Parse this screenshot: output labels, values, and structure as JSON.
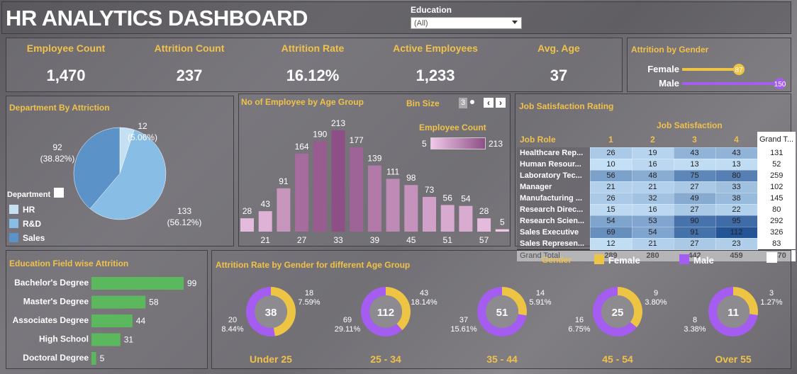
{
  "header": {
    "title": "HR ANALYTICS DASHBOARD",
    "filter_label": "Education",
    "filter_value": "(All)"
  },
  "kpis": [
    {
      "label": "Employee Count",
      "value": "1,470"
    },
    {
      "label": "Attrition Count",
      "value": "237"
    },
    {
      "label": "Attrition Rate",
      "value": "16.12%"
    },
    {
      "label": "Active Employees",
      "value": "1,233"
    },
    {
      "label": "Avg. Age",
      "value": "37"
    }
  ],
  "colors": {
    "accent": "#f0c24b",
    "female": "#eec444",
    "male": "#a55cf0",
    "edu_bar": "#5cb85c",
    "age_bar": "#8e4f86",
    "pie_rd": "#88bde6",
    "pie_sales": "#5b93c9",
    "pie_hr": "#c5e0f3"
  },
  "chart_data": [
    {
      "type": "bar",
      "title": "Attrition by Gender",
      "categories": [
        "Female",
        "Male"
      ],
      "values": [
        87,
        150
      ]
    },
    {
      "type": "pie",
      "title": "Department By Attriction",
      "legend_title": "Department",
      "categories": [
        "HR",
        "R&D",
        "Sales"
      ],
      "values": [
        12,
        133,
        92
      ],
      "labels": [
        [
          "12",
          "(5.06%)"
        ],
        [
          "133",
          "(56.12%)"
        ],
        [
          "92",
          "(38.82%)"
        ]
      ]
    },
    {
      "type": "bar",
      "title": "No of Employee by Age Group",
      "bin_label": "Bin Size",
      "bin_value": "3",
      "legend_title": "Employee Count",
      "legend_min": "5",
      "legend_max": "213",
      "x_ticks": [
        "21",
        "27",
        "33",
        "39",
        "45",
        "51",
        "57"
      ],
      "values": [
        28,
        43,
        91,
        164,
        190,
        213,
        177,
        139,
        111,
        98,
        73,
        56,
        54,
        28,
        5
      ]
    },
    {
      "type": "table",
      "title": "Job Satisfaction Rating",
      "column_group": "Job Satisfaction",
      "row_header": "Job Role",
      "columns": [
        "1",
        "2",
        "3",
        "4"
      ],
      "total_header": "Grand T...",
      "rows": [
        {
          "role": "Healthcare Rep...",
          "values": [
            26,
            19,
            43,
            43
          ],
          "total": "131"
        },
        {
          "role": "Human Resour...",
          "values": [
            10,
            16,
            13,
            13
          ],
          "total": "52"
        },
        {
          "role": "Laboratory Tec...",
          "values": [
            56,
            48,
            75,
            80
          ],
          "total": "259"
        },
        {
          "role": "Manager",
          "values": [
            21,
            21,
            27,
            33
          ],
          "total": "102"
        },
        {
          "role": "Manufacturing ...",
          "values": [
            26,
            32,
            49,
            38
          ],
          "total": "145"
        },
        {
          "role": "Research Direc...",
          "values": [
            15,
            16,
            27,
            22
          ],
          "total": "80"
        },
        {
          "role": "Research Scien...",
          "values": [
            54,
            53,
            90,
            95
          ],
          "total": "292"
        },
        {
          "role": "Sales Executive",
          "values": [
            69,
            54,
            91,
            112
          ],
          "total": "326"
        },
        {
          "role": "Sales Represen...",
          "values": [
            12,
            21,
            27,
            23
          ],
          "total": "83"
        }
      ],
      "grand_total": {
        "label": "Grand Total",
        "values": [
          "289",
          "280",
          "442",
          "459"
        ],
        "total": "1,470"
      }
    },
    {
      "type": "bar",
      "title": "Education Field wise Attrition",
      "categories": [
        "Bachelor's Degree",
        "Master's Degree",
        "Associates Degree",
        "High School",
        "Doctoral Degree"
      ],
      "values": [
        99,
        58,
        44,
        31,
        5
      ]
    },
    {
      "type": "pie",
      "title": "Attrition Rate by Gender for different Age Group",
      "legend_title": "Gender",
      "legend": [
        "Female",
        "Male"
      ],
      "groups": [
        {
          "label": "Under 25",
          "total": "38",
          "female": 18,
          "female_pct": "7.59%",
          "male": 20,
          "male_pct": "8.44%"
        },
        {
          "label": "25 - 34",
          "total": "112",
          "female": 43,
          "female_pct": "18.14%",
          "male": 69,
          "male_pct": "29.11%"
        },
        {
          "label": "35 - 44",
          "total": "51",
          "female": 14,
          "female_pct": "5.91%",
          "male": 37,
          "male_pct": "15.61%"
        },
        {
          "label": "45 - 54",
          "total": "25",
          "female": 9,
          "female_pct": "3.80%",
          "male": 16,
          "male_pct": "6.75%"
        },
        {
          "label": "Over 55",
          "total": "11",
          "female": 3,
          "female_pct": "1.27%",
          "male": 8,
          "male_pct": "3.38%"
        }
      ]
    }
  ]
}
